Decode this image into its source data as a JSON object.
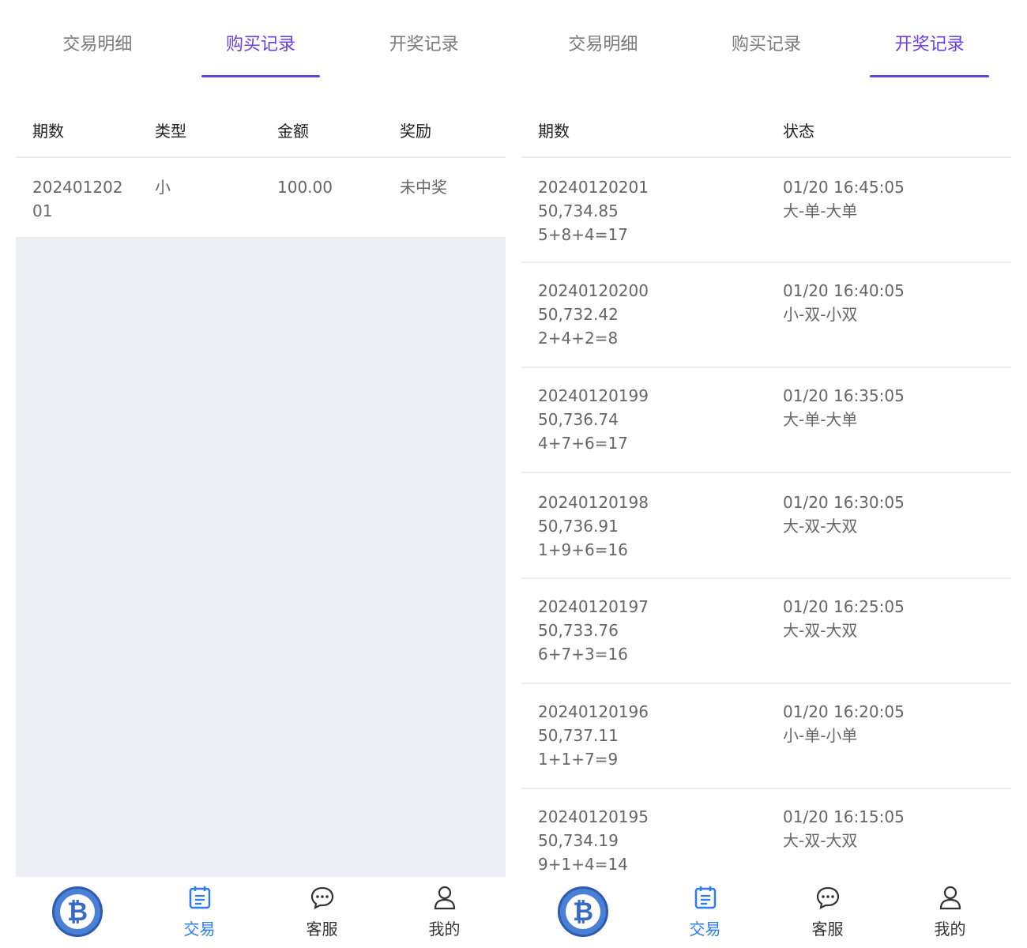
{
  "tabs": [
    "交易明细",
    "购买记录",
    "开奖记录"
  ],
  "purchase": {
    "headers": [
      "期数",
      "类型",
      "金额",
      "奖励"
    ],
    "rows": [
      {
        "period_line1": "202401202",
        "period_line2": "01",
        "type": "小",
        "amount": "100.00",
        "reward": "未中奖"
      }
    ]
  },
  "draws": {
    "headers": [
      "期数",
      "状态"
    ],
    "rows": [
      {
        "period": "20240120201",
        "price": "50,734.85",
        "formula": "5+8+4=17",
        "time": "01/20 16:45:05",
        "result": "大-单-大单"
      },
      {
        "period": "20240120200",
        "price": "50,732.42",
        "formula": "2+4+2=8",
        "time": "01/20 16:40:05",
        "result": "小-双-小双"
      },
      {
        "period": "20240120199",
        "price": "50,736.74",
        "formula": "4+7+6=17",
        "time": "01/20 16:35:05",
        "result": "大-单-大单"
      },
      {
        "period": "20240120198",
        "price": "50,736.91",
        "formula": "1+9+6=16",
        "time": "01/20 16:30:05",
        "result": "大-双-大双"
      },
      {
        "period": "20240120197",
        "price": "50,733.76",
        "formula": "6+7+3=16",
        "time": "01/20 16:25:05",
        "result": "大-双-大双"
      },
      {
        "period": "20240120196",
        "price": "50,737.11",
        "formula": "1+1+7=9",
        "time": "01/20 16:20:05",
        "result": "小-单-小单"
      },
      {
        "period": "20240120195",
        "price": "50,734.19",
        "formula": "9+1+4=14",
        "time": "01/20 16:15:05",
        "result": "大-双-大双"
      }
    ]
  },
  "nav": {
    "logo_icon": "bitcoin-icon",
    "items": [
      {
        "label": "交易",
        "icon": "calendar-icon"
      },
      {
        "label": "客服",
        "icon": "chat-icon"
      },
      {
        "label": "我的",
        "icon": "user-icon"
      }
    ]
  },
  "colors": {
    "accent": "#6a3fe0",
    "nav_active": "#2a7cf0",
    "divider": "#ececf2",
    "empty_bg": "#eeeff5"
  }
}
